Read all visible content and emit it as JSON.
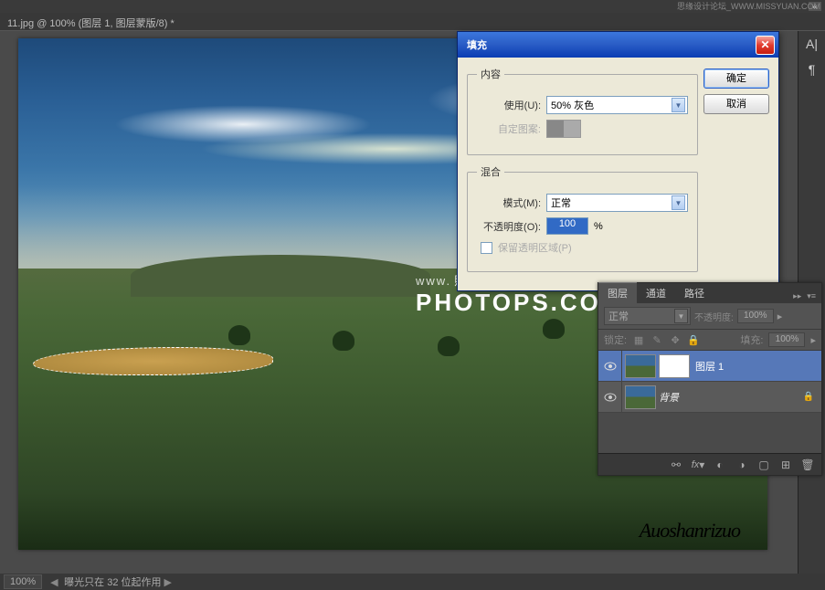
{
  "app_bar_watermark": "思缘设计论坛_WWW.MISSYUAN.COM",
  "doc_tab": "11.jpg @ 100% (图层 1, 图层蒙版/8) *",
  "sidebar_icons": [
    "A|",
    "¶"
  ],
  "watermark_photops": {
    "small": "www.",
    "big": "PHOTOPS.COM",
    "cn": "照片处理网"
  },
  "signature": "Auoshanrizuo",
  "status": {
    "zoom": "100%",
    "msg": "曝光只在 32 位起作用"
  },
  "dialog": {
    "title": "填充",
    "ok": "确定",
    "cancel": "取消",
    "content_legend": "内容",
    "use_label": "使用(U):",
    "use_value": "50% 灰色",
    "custom_pattern": "自定图案:",
    "blend_legend": "混合",
    "mode_label": "模式(M):",
    "mode_value": "正常",
    "opacity_label": "不透明度(O):",
    "opacity_value": "100",
    "pct": "%",
    "preserve_trans": "保留透明区域(P)"
  },
  "panel": {
    "tabs": [
      "图层",
      "通道",
      "路径"
    ],
    "blend_mode": "正常",
    "opacity_label": "不透明度:",
    "opacity": "100%",
    "lock_label": "锁定:",
    "fill_label": "填充:",
    "fill": "100%",
    "layers": [
      {
        "name": "图层 1",
        "selected": true,
        "mask": true
      },
      {
        "name": "背景",
        "selected": false,
        "italic": true,
        "locked": true
      }
    ]
  }
}
